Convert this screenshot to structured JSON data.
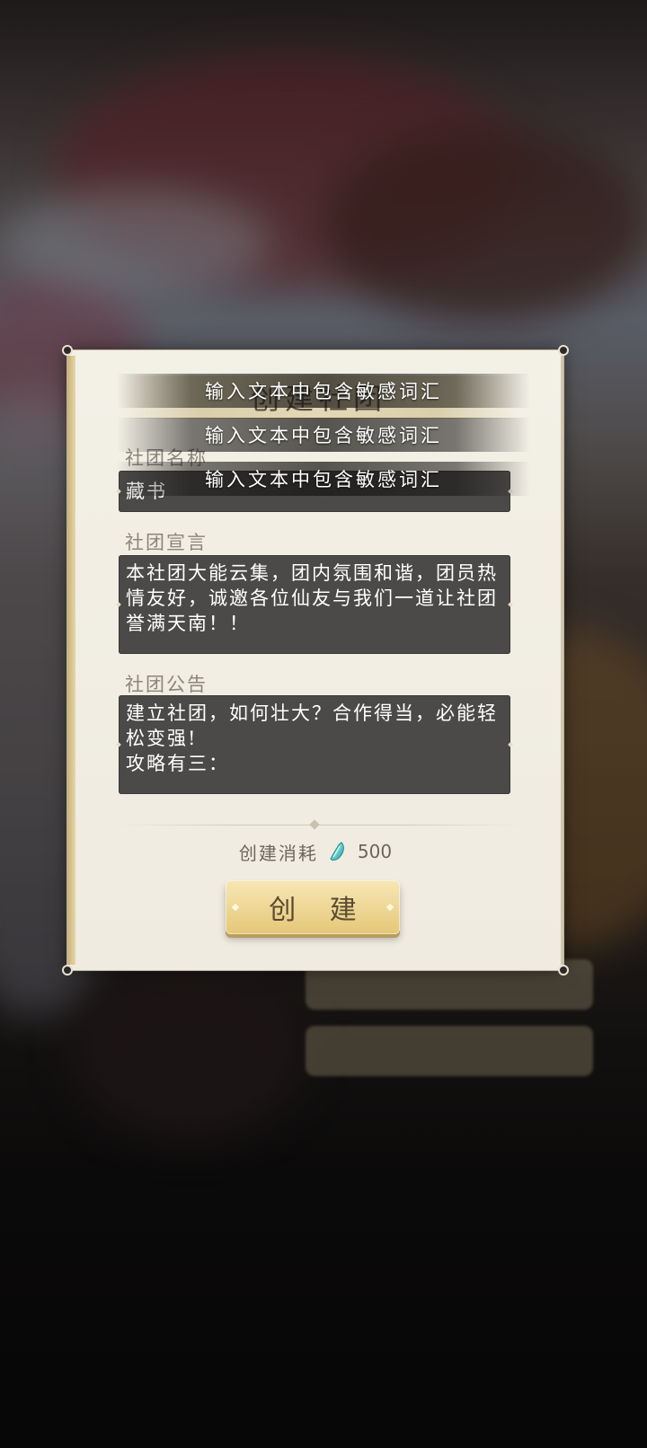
{
  "dialog": {
    "title": "创建社团",
    "name_label": "社团名称",
    "name_value": "藏书",
    "manifesto_label": "社团宣言",
    "manifesto_value": "本社团大能云集，团内氛围和谐，团员热情友好，诚邀各位仙友与我们一道让社团誉满天南！！",
    "notice_label": "社团公告",
    "notice_line1": "建立社团，如何壮大？合作得当，必能轻松变强!",
    "notice_line2": "攻略有三：",
    "cost_label": "创建消耗",
    "cost_icon": "spirit-jade-icon",
    "cost_value": "500",
    "create_button": "创 建"
  },
  "toasts": [
    "输入文本中包含敏感词汇",
    "输入文本中包含敏感词汇",
    "输入文本中包含敏感词汇"
  ],
  "colors": {
    "panel": "#efebe0",
    "field": "#4b4a48",
    "button": "#efd99a",
    "label": "#8c857a"
  }
}
